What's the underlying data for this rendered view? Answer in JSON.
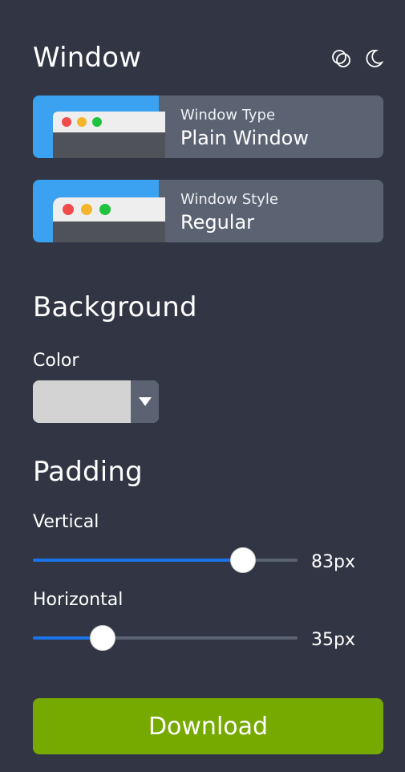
{
  "window": {
    "title": "Window",
    "icons": [
      "theme-circles-icon",
      "moon-icon"
    ],
    "type_card": {
      "label": "Window Type",
      "value": "Plain Window"
    },
    "style_card": {
      "label": "Window Style",
      "value": "Regular"
    }
  },
  "background": {
    "title": "Background",
    "color_label": "Color",
    "color_value": "#d3d3d3"
  },
  "padding": {
    "title": "Padding",
    "vertical": {
      "label": "Vertical",
      "value_text": "83px",
      "fraction": 0.79
    },
    "horizontal": {
      "label": "Horizontal",
      "value_text": "35px",
      "fraction": 0.26
    }
  },
  "download_label": "Download",
  "colors": {
    "background": "#323644",
    "card": "#5b6373",
    "thumb_blue": "#3aa2f0",
    "slider_fill": "#1a73e8",
    "download": "#76aa00",
    "traffic_red": "#f14b4b",
    "traffic_yellow": "#f5b52a",
    "traffic_green": "#20c33f"
  }
}
